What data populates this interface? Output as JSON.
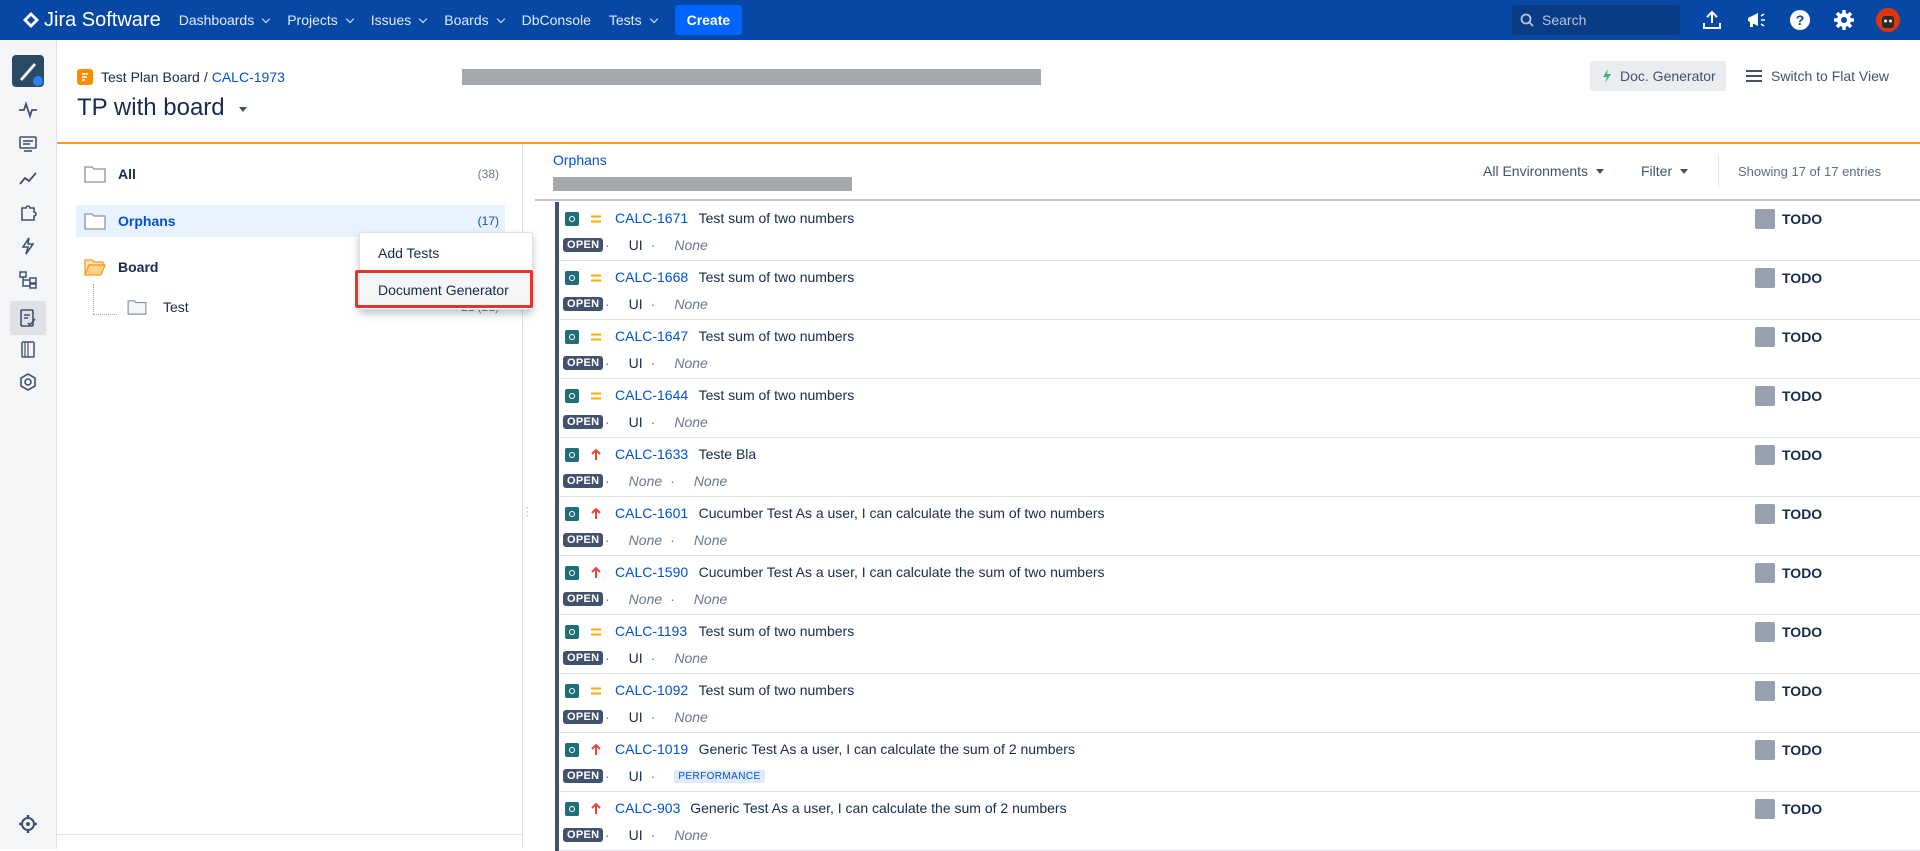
{
  "topnav": {
    "brand": "Jira Software",
    "items": [
      "Dashboards",
      "Projects",
      "Issues",
      "Boards",
      "DbConsole",
      "Tests"
    ],
    "create_label": "Create",
    "search_placeholder": "Search",
    "bg_color": "#0747a6"
  },
  "header": {
    "breadcrumb_parent": "Test Plan Board",
    "breadcrumb_sep": "/",
    "breadcrumb_key": "CALC-1973",
    "title": "TP with board",
    "docgen_label": "Doc. Generator",
    "flat_view_label": "Switch to Flat View"
  },
  "tree": {
    "all_label": "All",
    "all_count": "(38)",
    "orphans_label": "Orphans",
    "orphans_count": "(17)",
    "board_label": "Board",
    "test_label": "Test",
    "test_count": "21 (21)"
  },
  "context_menu": {
    "items": [
      "Add Tests",
      "Document Generator"
    ],
    "highlighted": "Document Generator"
  },
  "panel": {
    "folder_link": "Orphans",
    "env_label": "All Environments",
    "filter_label": "Filter",
    "showing": "Showing 17 of 17 entries"
  },
  "rows": [
    {
      "key": "CALC-1671",
      "summary": "Test sum of two numbers",
      "priority": "medium",
      "status": "OPEN",
      "component": "UI",
      "label": "None",
      "result": "TODO"
    },
    {
      "key": "CALC-1668",
      "summary": "Test sum of two numbers",
      "priority": "medium",
      "status": "OPEN",
      "component": "UI",
      "label": "None",
      "result": "TODO"
    },
    {
      "key": "CALC-1647",
      "summary": "Test sum of two numbers",
      "priority": "medium",
      "status": "OPEN",
      "component": "UI",
      "label": "None",
      "result": "TODO"
    },
    {
      "key": "CALC-1644",
      "summary": "Test sum of two numbers",
      "priority": "medium",
      "status": "OPEN",
      "component": "UI",
      "label": "None",
      "result": "TODO"
    },
    {
      "key": "CALC-1633",
      "summary": "Teste Bla",
      "priority": "high",
      "status": "OPEN",
      "component": "None",
      "label": "None",
      "result": "TODO"
    },
    {
      "key": "CALC-1601",
      "summary": "Cucumber Test As a user, I can calculate the sum of two numbers",
      "priority": "high",
      "status": "OPEN",
      "component": "None",
      "label": "None",
      "result": "TODO"
    },
    {
      "key": "CALC-1590",
      "summary": "Cucumber Test As a user, I can calculate the sum of two numbers",
      "priority": "high",
      "status": "OPEN",
      "component": "None",
      "label": "None",
      "result": "TODO"
    },
    {
      "key": "CALC-1193",
      "summary": "Test sum of two numbers",
      "priority": "medium",
      "status": "OPEN",
      "component": "UI",
      "label": "None",
      "result": "TODO"
    },
    {
      "key": "CALC-1092",
      "summary": "Test sum of two numbers",
      "priority": "medium",
      "status": "OPEN",
      "component": "UI",
      "label": "None",
      "result": "TODO"
    },
    {
      "key": "CALC-1019",
      "summary": "Generic Test As a user, I can calculate the sum of 2 numbers",
      "priority": "high",
      "status": "OPEN",
      "component": "UI",
      "label": "PERFORMANCE",
      "result": "TODO"
    },
    {
      "key": "CALC-903",
      "summary": "Generic Test As a user, I can calculate the sum of 2 numbers",
      "priority": "high",
      "status": "OPEN",
      "component": "UI",
      "label": "None",
      "result": "TODO"
    }
  ]
}
